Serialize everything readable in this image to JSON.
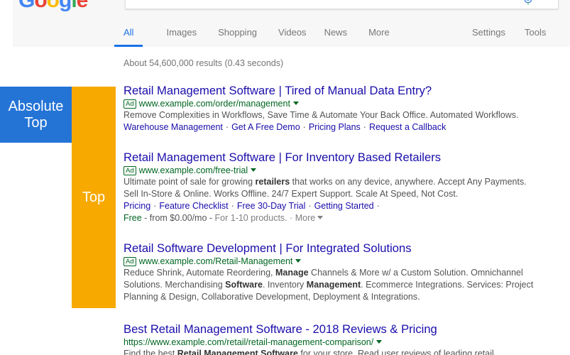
{
  "logo": {
    "letters": [
      "G",
      "o",
      "o",
      "g",
      "l",
      "e"
    ],
    "colors": [
      "#4285f4",
      "#ea4335",
      "#fbbc05",
      "#4285f4",
      "#34a853",
      "#ea4335"
    ]
  },
  "icons": {
    "mic": "microphone-icon",
    "ad_caret": "caret-down-icon",
    "more_caret": "caret-down-icon"
  },
  "tabs": {
    "all": "All",
    "images": "Images",
    "shopping": "Shopping",
    "videos": "Videos",
    "news": "News",
    "more": "More",
    "settings": "Settings",
    "tools": "Tools"
  },
  "stats": "About 54,600,000 results (0.43 seconds)",
  "bands": {
    "absolute_top": [
      "Absolute",
      "Top"
    ],
    "top": "Top"
  },
  "colors": {
    "link": "#1a0dab",
    "url": "#006621",
    "text": "#545454",
    "absolute_top_band": "#2474d6",
    "top_band": "#f7a900",
    "active_tab": "#1a73e8"
  },
  "results": [
    {
      "title": "Retail Management Software | Tired of Manual Data Entry?",
      "ad_label": "Ad",
      "url": "www.example.com/order/management",
      "desc": "Remove Complexities in Workflows, Save Time & Automate Your Back Office. Automated Workflows.",
      "sitelinks": [
        "Warehouse Management",
        "Get A Free Demo",
        "Pricing Plans",
        "Request a Callback"
      ]
    },
    {
      "title": "Retail Management Software | For Inventory Based Retailers",
      "ad_label": "Ad",
      "url": "www.example.com/free-trial",
      "desc_line1": [
        "Ultimate point of sale for growing ",
        "retailers",
        " that works on any device, anywhere. Accept Any Payments."
      ],
      "desc_line2": "Sell In-Store & Online. Works Offline. 24/7 Expert Support. Scale At Speed, Not Cost.",
      "sitelinks": [
        "Pricing",
        "Feature Checklist",
        "Free 30-Day Trial",
        "Getting Started"
      ],
      "price": {
        "label": "Free",
        "from": " - from $0.00/mo - ",
        "detail": "For 1-10 products.",
        "sep": " · ",
        "more": "More"
      }
    },
    {
      "title": "Retail Software Development | For Integrated Solutions",
      "ad_label": "Ad",
      "url": "www.example.com/Retail-Management",
      "desc_line1": [
        "Reduce Shrink, Automate Reordering, ",
        "Manage",
        " Channels & More w/ a Custom Solution. Omnichannel"
      ],
      "desc_line2": [
        "Solutions. Merchandising ",
        "Software",
        ". Inventory ",
        "Management",
        ". Ecommerce Integrations. Services: Project"
      ],
      "desc_line3": "Planning & Design, Collaborative Development, Deployment & Integrations."
    },
    {
      "title": "Best Retail Management Software - 2018 Reviews & Pricing",
      "url": "https://www.example.com/retail/retail-management-comparison/",
      "desc_line1": [
        "Find the best ",
        "Retail Management Software",
        " for your store. Read user reviews of leading retail"
      ]
    }
  ]
}
